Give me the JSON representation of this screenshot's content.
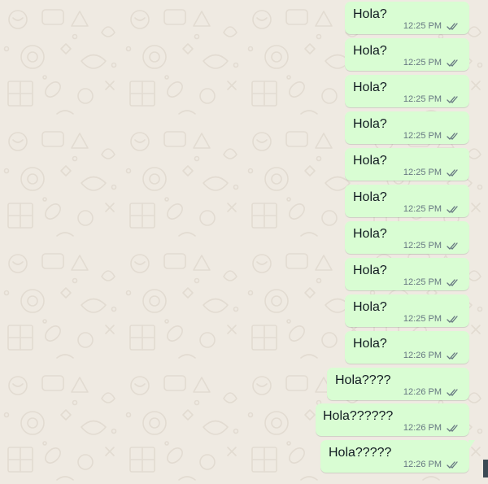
{
  "chat": {
    "messages": [
      {
        "text": "Hola?",
        "time": "12:25 PM",
        "status": "read-ticks-icon"
      },
      {
        "text": "Hola?",
        "time": "12:25 PM",
        "status": "read-ticks-icon"
      },
      {
        "text": "Hola?",
        "time": "12:25 PM",
        "status": "read-ticks-icon"
      },
      {
        "text": "Hola?",
        "time": "12:25 PM",
        "status": "read-ticks-icon"
      },
      {
        "text": "Hola?",
        "time": "12:25 PM",
        "status": "read-ticks-icon"
      },
      {
        "text": "Hola?",
        "time": "12:25 PM",
        "status": "read-ticks-icon"
      },
      {
        "text": "Hola?",
        "time": "12:25 PM",
        "status": "read-ticks-icon"
      },
      {
        "text": "Hola?",
        "time": "12:25 PM",
        "status": "read-ticks-icon"
      },
      {
        "text": "Hola?",
        "time": "12:25 PM",
        "status": "read-ticks-icon"
      },
      {
        "text": "Hola?",
        "time": "12:26 PM",
        "status": "read-ticks-icon"
      },
      {
        "text": "Hola????",
        "time": "12:26 PM",
        "status": "read-ticks-icon"
      },
      {
        "text": "Hola??????",
        "time": "12:26 PM",
        "status": "read-ticks-icon"
      },
      {
        "text": "Hola?????",
        "time": "12:26 PM",
        "status": "read-ticks-icon"
      }
    ]
  },
  "colors": {
    "background": "#efeae2",
    "outgoing_bubble": "#d9fdd3",
    "text": "#111b21",
    "meta": "#667781"
  }
}
